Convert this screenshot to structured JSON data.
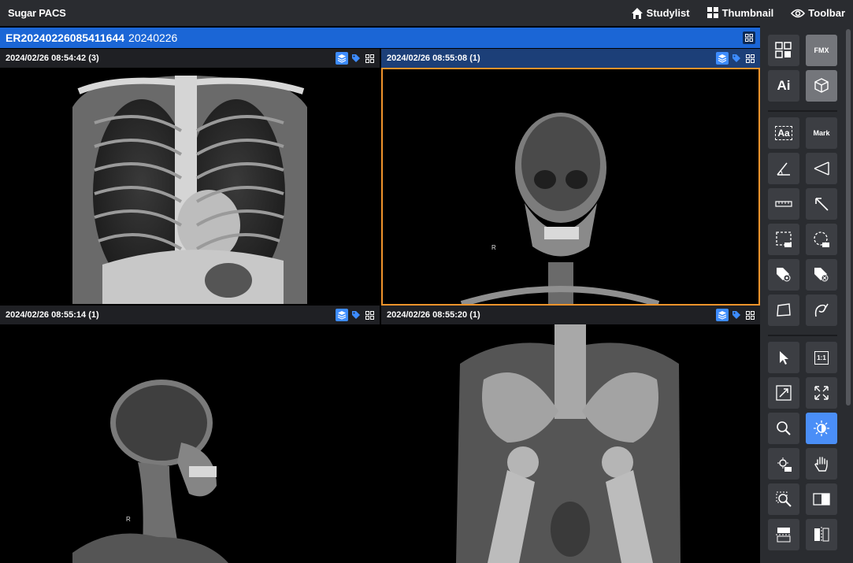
{
  "app": {
    "title": "Sugar PACS"
  },
  "nav": {
    "studylist": "Studylist",
    "thumbnail": "Thumbnail",
    "toolbar": "Toolbar"
  },
  "study": {
    "id": "ER20240226085411644",
    "date": "20240226"
  },
  "viewports": [
    {
      "timestamp": "2024/02/26 08:54:42 (3)",
      "image": "chest x-ray",
      "active": false
    },
    {
      "timestamp": "2024/02/26 08:55:08 (1)",
      "image": "skull x-ray frontal",
      "active": true,
      "marker": "R"
    },
    {
      "timestamp": "2024/02/26 08:55:14 (1)",
      "image": "skull x-ray lateral",
      "active": false,
      "marker": "R"
    },
    {
      "timestamp": "2024/02/26 08:55:20 (1)",
      "image": "pelvis x-ray",
      "active": false
    }
  ],
  "tools": {
    "fmx": "FMX",
    "ai": "Ai",
    "text": "Aa",
    "mark": "Mark",
    "one_to_one": "1:1"
  },
  "colors": {
    "accent": "#1b66d6",
    "active_tool": "#4a8ef7",
    "active_border": "#f0932b"
  }
}
